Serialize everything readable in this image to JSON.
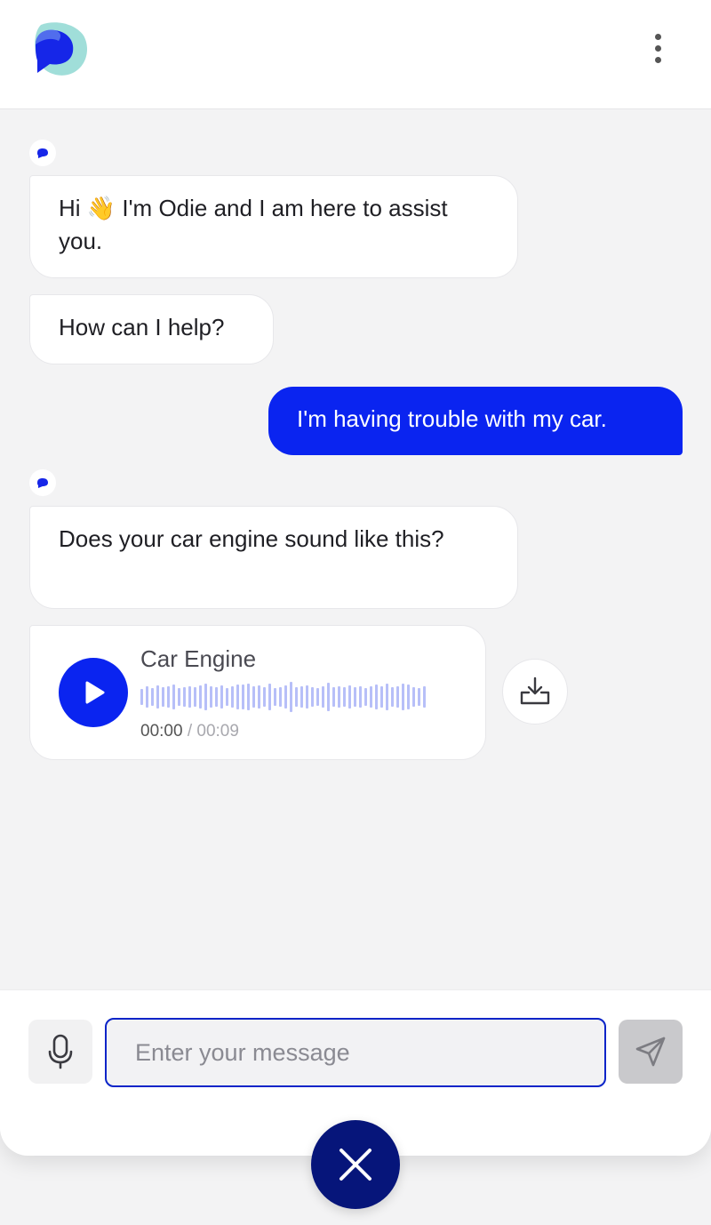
{
  "header": {
    "logo_icon": "odie-chat-logo-icon",
    "menu_icon": "more-vertical-icon"
  },
  "messages": [
    {
      "sender": "bot",
      "text": "Hi 👋 I'm Odie and I am here to assist you."
    },
    {
      "sender": "bot",
      "text": "How can I help?"
    },
    {
      "sender": "user",
      "text": "I'm having trouble with my car."
    },
    {
      "sender": "bot",
      "text": "Does your car engine sound like this?"
    }
  ],
  "audio": {
    "title": "Car Engine",
    "current_time": "00:00",
    "separator": " / ",
    "duration": "00:09",
    "play_icon": "play-icon",
    "download_icon": "download-icon"
  },
  "composer": {
    "placeholder": "Enter your message",
    "value": "",
    "mic_icon": "microphone-icon",
    "send_icon": "send-icon"
  },
  "close_icon": "close-icon",
  "colors": {
    "accent": "#0a24f0",
    "dark_accent": "#06157a",
    "chat_background": "#f3f3f4",
    "waveform": "#b7bff8"
  }
}
